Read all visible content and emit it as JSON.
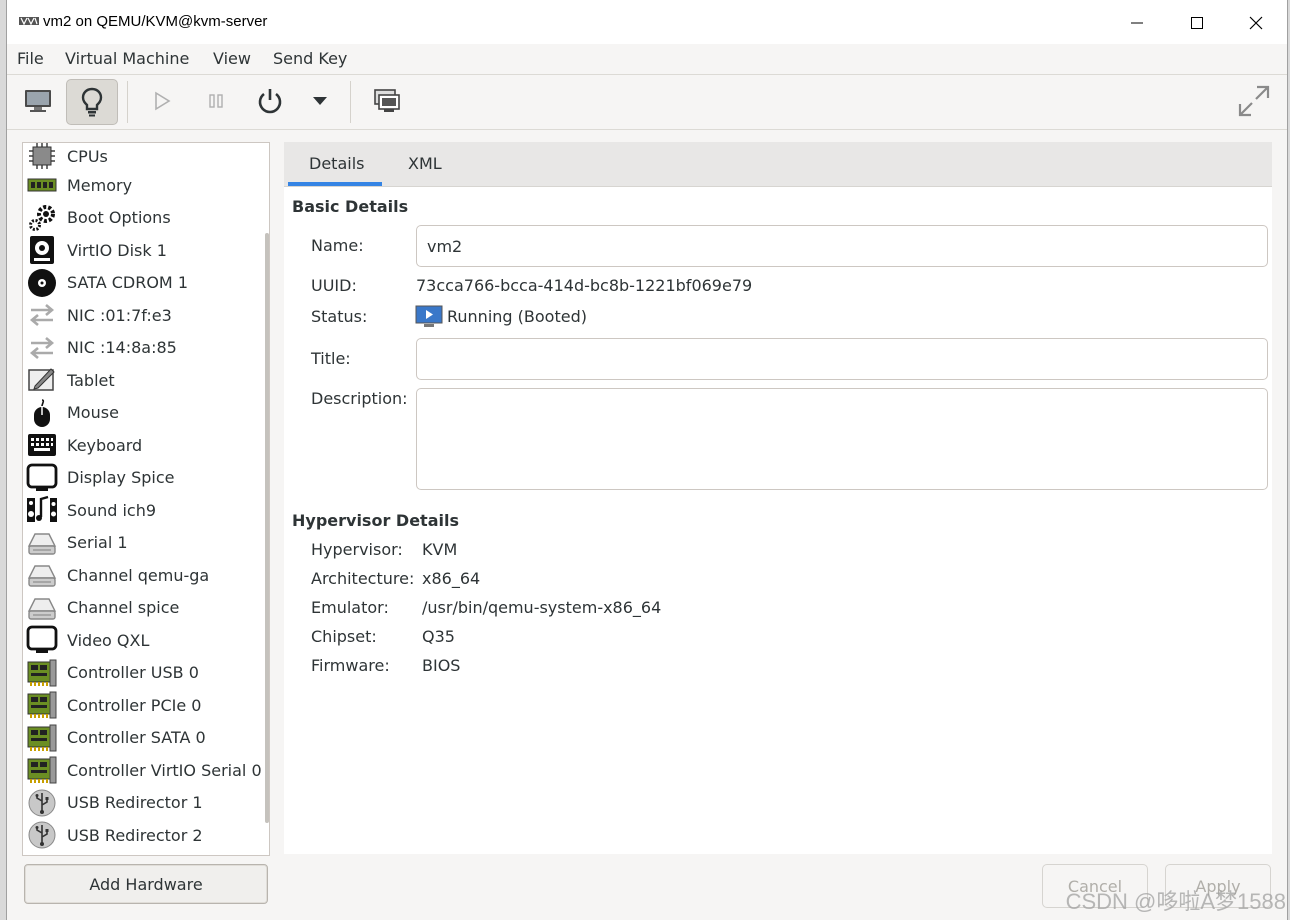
{
  "window": {
    "title": "vm2 on QEMU/KVM@kvm-server",
    "minimize_icon": "minimize-icon",
    "maximize_icon": "maximize-icon",
    "close_icon": "close-icon"
  },
  "menu": [
    "File",
    "Virtual Machine",
    "View",
    "Send Key"
  ],
  "toolbar": {
    "buttons": [
      "console-icon",
      "lightbulb-icon",
      "play-icon",
      "pause-icon",
      "power-icon",
      "dropdown-icon",
      "snapshot-icon",
      "fullscreen-icon"
    ],
    "active": "lightbulb-icon"
  },
  "sidebar": {
    "items": [
      {
        "label": "CPUs",
        "icon": "cpu-icon"
      },
      {
        "label": "Memory",
        "icon": "memory-icon"
      },
      {
        "label": "Boot Options",
        "icon": "gears-icon"
      },
      {
        "label": "VirtIO Disk 1",
        "icon": "disk-icon"
      },
      {
        "label": "SATA CDROM 1",
        "icon": "cdrom-icon"
      },
      {
        "label": "NIC :01:7f:e3",
        "icon": "nic-icon"
      },
      {
        "label": "NIC :14:8a:85",
        "icon": "nic-icon"
      },
      {
        "label": "Tablet",
        "icon": "tablet-icon"
      },
      {
        "label": "Mouse",
        "icon": "mouse-icon"
      },
      {
        "label": "Keyboard",
        "icon": "keyboard-icon"
      },
      {
        "label": "Display Spice",
        "icon": "display-icon"
      },
      {
        "label": "Sound ich9",
        "icon": "sound-icon"
      },
      {
        "label": "Serial 1",
        "icon": "serial-icon"
      },
      {
        "label": "Channel qemu-ga",
        "icon": "serial-icon"
      },
      {
        "label": "Channel spice",
        "icon": "serial-icon"
      },
      {
        "label": "Video QXL",
        "icon": "display-icon"
      },
      {
        "label": "Controller USB 0",
        "icon": "controller-icon"
      },
      {
        "label": "Controller PCIe 0",
        "icon": "controller-icon"
      },
      {
        "label": "Controller SATA 0",
        "icon": "controller-icon"
      },
      {
        "label": "Controller VirtIO Serial 0",
        "icon": "controller-icon"
      },
      {
        "label": "USB Redirector 1",
        "icon": "usb-icon"
      },
      {
        "label": "USB Redirector 2",
        "icon": "usb-icon"
      }
    ],
    "add_hardware": "Add Hardware"
  },
  "tabs": [
    "Details",
    "XML"
  ],
  "basic": {
    "title": "Basic Details",
    "name_label": "Name:",
    "name_value": "vm2",
    "uuid_label": "UUID:",
    "uuid_value": "73cca766-bcca-414d-bc8b-1221bf069e79",
    "status_label": "Status:",
    "status_value": "Running (Booted)",
    "title_label": "Title:",
    "title_value": "",
    "description_label": "Description:",
    "description_value": ""
  },
  "hypervisor": {
    "title": "Hypervisor Details",
    "rows": [
      {
        "label": "Hypervisor:",
        "value": "KVM"
      },
      {
        "label": "Architecture:",
        "value": "x86_64"
      },
      {
        "label": "Emulator:",
        "value": "/usr/bin/qemu-system-x86_64"
      },
      {
        "label": "Chipset:",
        "value": "Q35"
      },
      {
        "label": "Firmware:",
        "value": "BIOS"
      }
    ]
  },
  "buttons": {
    "cancel": "Cancel",
    "apply": "Apply"
  },
  "watermark": "CSDN @哆啦A梦1588"
}
